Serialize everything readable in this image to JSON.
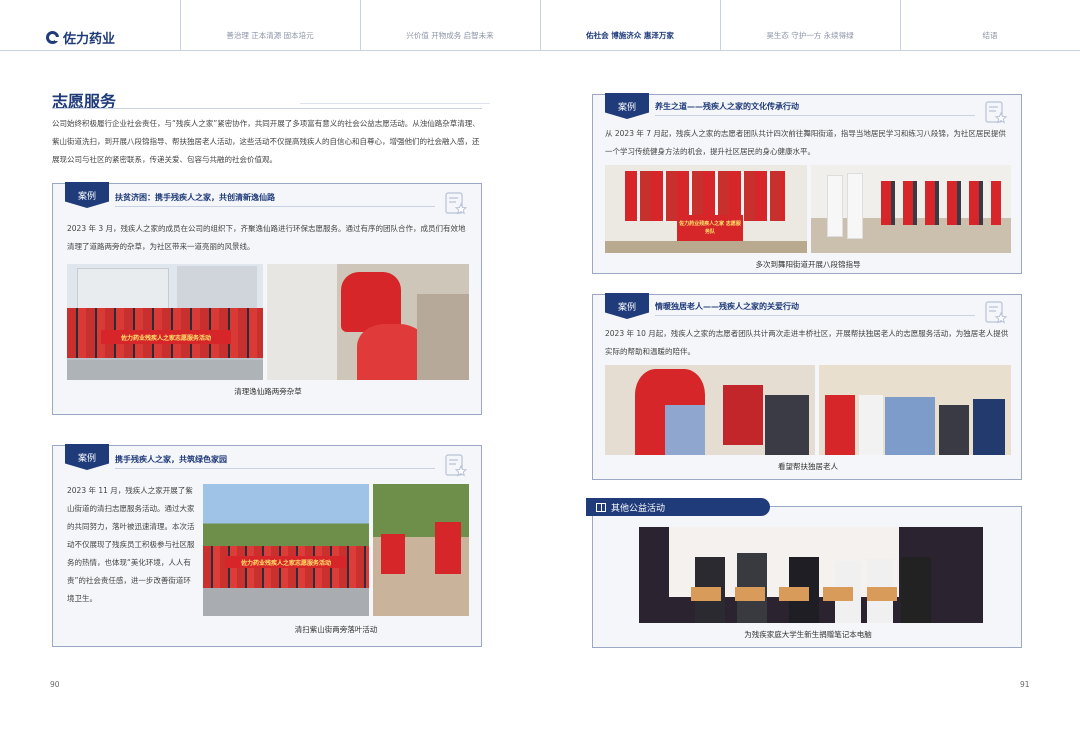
{
  "header": {
    "logo_text": "佐力药业",
    "nav": [
      {
        "label": "善治理 正本清源 固本培元",
        "active": false
      },
      {
        "label": "兴价值 开物成务 启智未来",
        "active": false
      },
      {
        "label": "佑社会 博施济众 惠泽万家",
        "active": true
      },
      {
        "label": "昊生态 守护一方 永续得绿",
        "active": false
      },
      {
        "label": "结语",
        "active": false
      }
    ]
  },
  "left_page": {
    "section_title": "志愿服务",
    "intro": "公司始终积极履行企业社会责任，与“残疾人之家”紧密协作，共同开展了多项富有意义的社会公益志愿活动。从浊仙路杂草清理、紫山街道洗扫，到开展八段锦指导、帮扶独居老人活动，这些活动不仅提高残疾人的自信心和自尊心，增强他们的社会融入感，还展现公司与社区的紧密联系，传递关爱、包容与共融的社会价值观。",
    "case1": {
      "badge": "案例",
      "title": "扶贫济困：携手残疾人之家，共创清新逸仙路",
      "text": "2023 年 3 月，残疾人之家的成员在公司的组织下，齐聚逸仙路进行环保志愿服务。通过有序的团队合作，成员们有效地清理了道路两旁的杂草，为社区带来一道亮丽的风景线。",
      "banner": "佐力药业残疾人之家志愿服务活动",
      "caption": "清理逸仙路两旁杂草"
    },
    "case2": {
      "badge": "案例",
      "title": "携手残疾人之家，共筑绿色家园",
      "text": "2023 年 11 月，残疾人之家开展了紫山街道的清扫志愿服务活动。通过大家的共同努力，落叶被迅速清理。本次活动不仅展现了残疾员工积极参与社区服务的热情，也体现“美化环境，人人有责”的社会责任感，进一步改善街道环境卫生。",
      "banner": "佐力药业残疾人之家志愿服务活动",
      "caption": "清扫紫山街两旁落叶活动"
    },
    "page_number": "90"
  },
  "right_page": {
    "case3": {
      "badge": "案例",
      "title": "养生之道——残疾人之家的文化传承行动",
      "text": "从 2023 年 7 月起，残疾人之家的志愿者团队共计四次前往舞阳街道，指导当地居民学习和练习八段锦，为社区居民提供一个学习传统健身方法的机会，提升社区居民的身心健康水平。",
      "banner": "佐力药业残疾人之家 志愿服务队",
      "caption": "多次到舞阳街道开展八段锦指导"
    },
    "case4": {
      "badge": "案例",
      "title": "情暖独居老人——残疾人之家的关爱行动",
      "text": "2023 年 10 月起，残疾人之家的志愿者团队共计两次走进丰桥社区，开展帮扶独居老人的志愿服务活动，为独居老人提供实际的帮助和温暖的陪伴。",
      "caption": "看望帮扶独居老人"
    },
    "other": {
      "title": "其他公益活动",
      "caption": "为残疾家庭大学生新生捐赠笔记本电脑"
    },
    "page_number": "91"
  },
  "colors": {
    "brand_blue": "#1f3b7a",
    "card_border": "#9aa8c6",
    "card_bg": "#f5f6f9",
    "vest_red": "#d6262a"
  },
  "icons": [
    "logo-icon",
    "certificate-star-icon",
    "gift-icon"
  ]
}
